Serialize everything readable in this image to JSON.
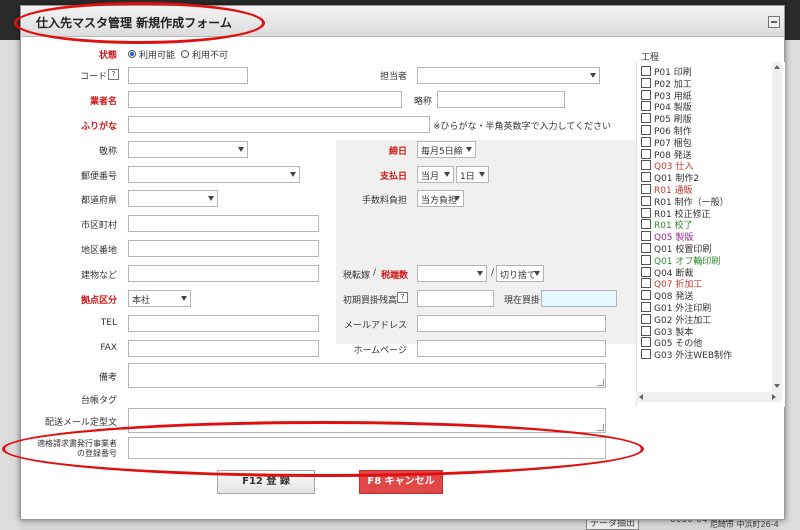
{
  "background": {
    "bottom_button": "データ抽出",
    "bottom_text1": "0000-04-0164",
    "bottom_text2": "尼崎市 中浜町26-4"
  },
  "dialog": {
    "title": "仕入先マスタ管理 新規作成フォーム"
  },
  "form": {
    "status_label": "状態",
    "status_options": [
      "利用可能",
      "利用不可"
    ],
    "code_label": "コード",
    "code_help": "?",
    "person_label": "担当者",
    "name_label": "業者名",
    "abbr_label": "略称",
    "kana_label": "ふりがな",
    "kana_note": "※ひらがな・半角英数字で入力してください",
    "honorific_label": "敬称",
    "closing_label": "締日",
    "closing_value": "毎月5日締",
    "zip_label": "郵便番号",
    "payday_label": "支払日",
    "pay_month_value": "当月",
    "pay_day_value": "1日",
    "pref_label": "都道府県",
    "fee_label": "手数料負担",
    "fee_value": "当方負担",
    "city_label": "市区町村",
    "area_label": "地区番地",
    "building_label": "建物など",
    "tax_label": "税転嫁",
    "tax_sep": "/",
    "tax_round_label": "税端数",
    "tax_round_sep": "/",
    "tax_round_value": "切り捨て",
    "base_label": "拠点区分",
    "base_value": "本社",
    "initial_balance_label": "初期買掛残高",
    "initial_balance_help": "?",
    "current_balance_label": "現在買掛",
    "tel_label": "TEL",
    "mail_label": "メールアドレス",
    "fax_label": "FAX",
    "homepage_label": "ホームページ",
    "remarks_label": "備考",
    "ledger_tag_label": "台帳タグ",
    "delivery_mail_label": "配送メール定型文",
    "invoice_label_line1": "適格請求書発行事業者",
    "invoice_label_line2": "の登録番号"
  },
  "process": {
    "label": "工程",
    "items": [
      {
        "text": "P01 印刷",
        "color": "#333333"
      },
      {
        "text": "P02 加工",
        "color": "#333333"
      },
      {
        "text": "P03 用紙",
        "color": "#333333"
      },
      {
        "text": "P04 製版",
        "color": "#333333"
      },
      {
        "text": "P05 刷版",
        "color": "#333333"
      },
      {
        "text": "P06 制作",
        "color": "#333333"
      },
      {
        "text": "P07 梱包",
        "color": "#333333"
      },
      {
        "text": "P08 発送",
        "color": "#333333"
      },
      {
        "text": "Q03 仕入",
        "color": "#c0392b"
      },
      {
        "text": "Q01 制作2",
        "color": "#333333"
      },
      {
        "text": "R01 通販",
        "color": "#c0392b"
      },
      {
        "text": "R01 制作（一般）",
        "color": "#333333"
      },
      {
        "text": "R01 校正修正",
        "color": "#333333"
      },
      {
        "text": "R01 校了",
        "color": "#2e8b2e"
      },
      {
        "text": "Q05 製版",
        "color": "#8e2a8e"
      },
      {
        "text": "Q01 校置印刷",
        "color": "#333333"
      },
      {
        "text": "Q01 オフ輪印刷",
        "color": "#2e8b2e"
      },
      {
        "text": "Q04 断裁",
        "color": "#333333"
      },
      {
        "text": "Q07 折加工",
        "color": "#c0392b"
      },
      {
        "text": "Q08 発送",
        "color": "#333333"
      },
      {
        "text": "G01 外注印刷",
        "color": "#333333"
      },
      {
        "text": "G02 外注加工",
        "color": "#333333"
      },
      {
        "text": "G03 製本",
        "color": "#333333"
      },
      {
        "text": "G05 その他",
        "color": "#333333"
      },
      {
        "text": "G03 外注WEB制作",
        "color": "#333333"
      }
    ]
  },
  "buttons": {
    "register": "F12 登 録",
    "cancel": "F8 キャンセル"
  },
  "colors": {
    "required": "#d01818",
    "cancel_bg": "#e04848",
    "annotation_oval": "#e01010"
  }
}
